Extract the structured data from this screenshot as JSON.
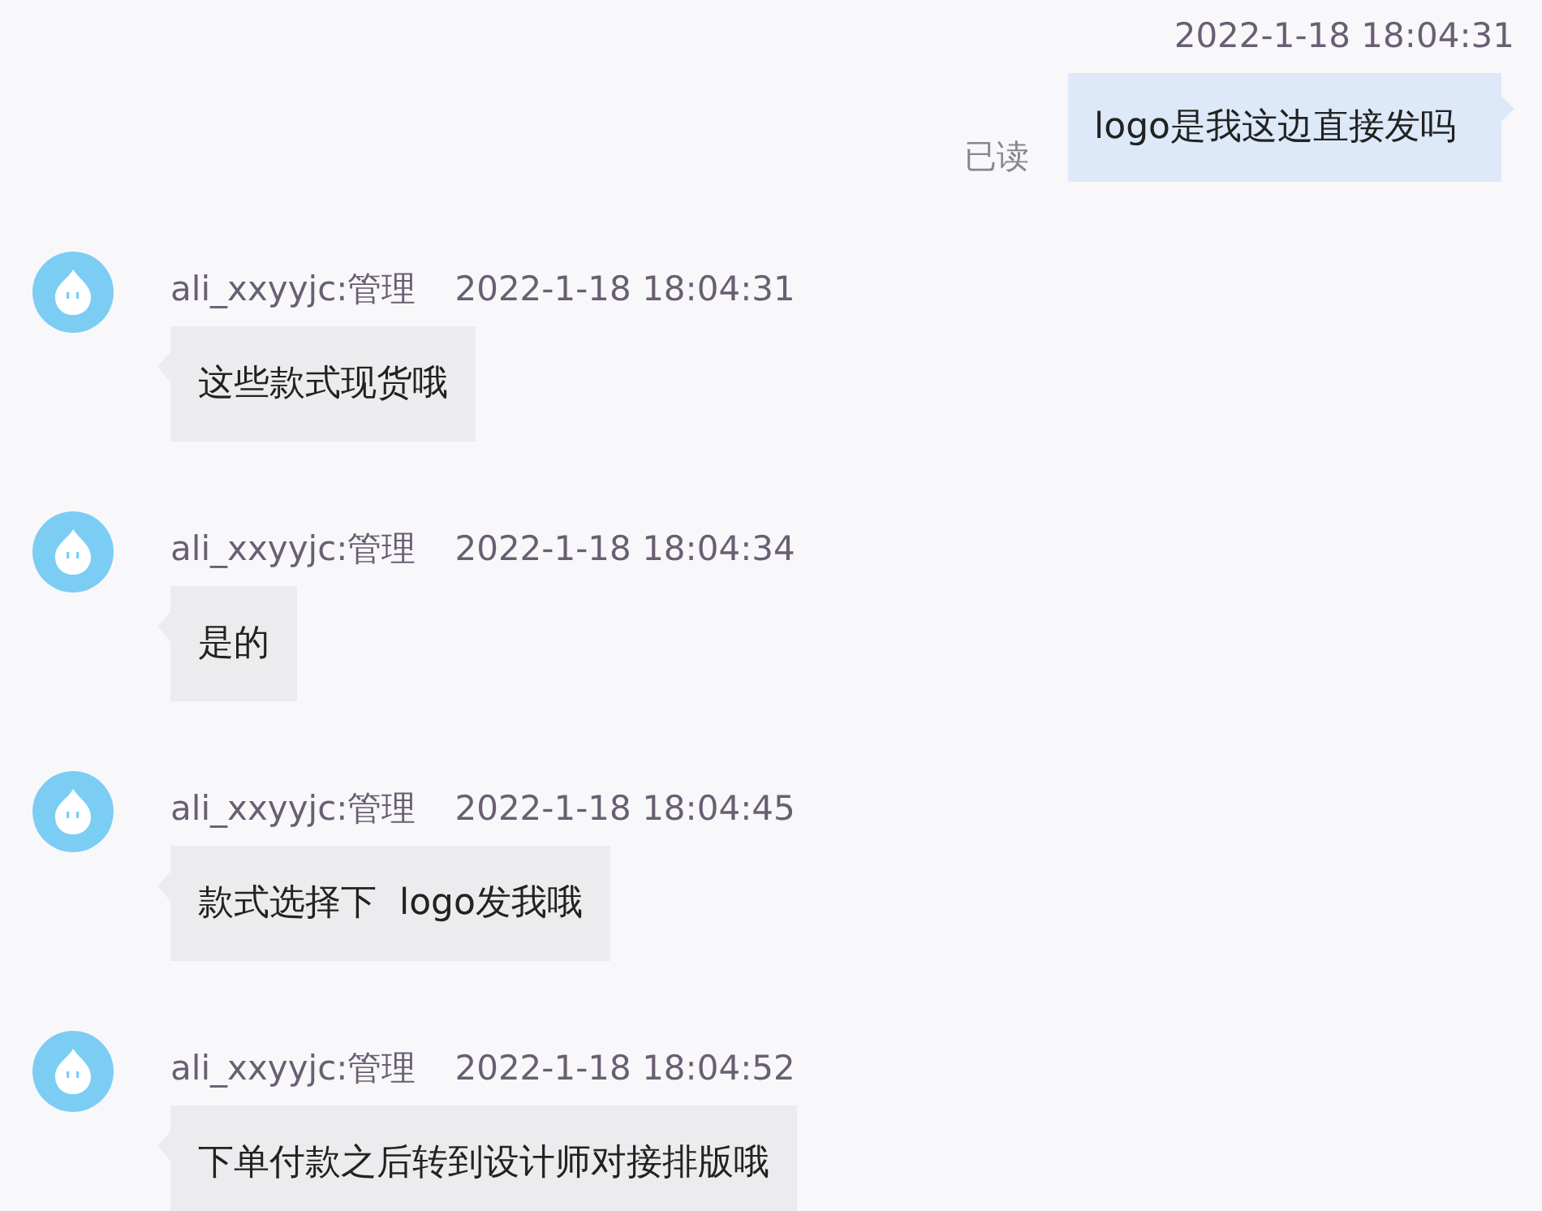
{
  "messages": [
    {
      "kind": "sent",
      "time": "2022-1-18 18:04:31",
      "status": "已读",
      "text": "logo是我这边直接发吗"
    },
    {
      "kind": "received",
      "sender": "ali_xxyyjc:管理",
      "time": "2022-1-18 18:04:31",
      "text": "这些款式现货哦"
    },
    {
      "kind": "received",
      "sender": "ali_xxyyjc:管理",
      "time": "2022-1-18 18:04:34",
      "text": "是的"
    },
    {
      "kind": "received",
      "sender": "ali_xxyyjc:管理",
      "time": "2022-1-18 18:04:45",
      "text": "款式选择下  logo发我哦"
    },
    {
      "kind": "received",
      "sender": "ali_xxyyjc:管理",
      "time": "2022-1-18 18:04:52",
      "text": "下单付款之后转到设计师对接排版哦"
    }
  ]
}
